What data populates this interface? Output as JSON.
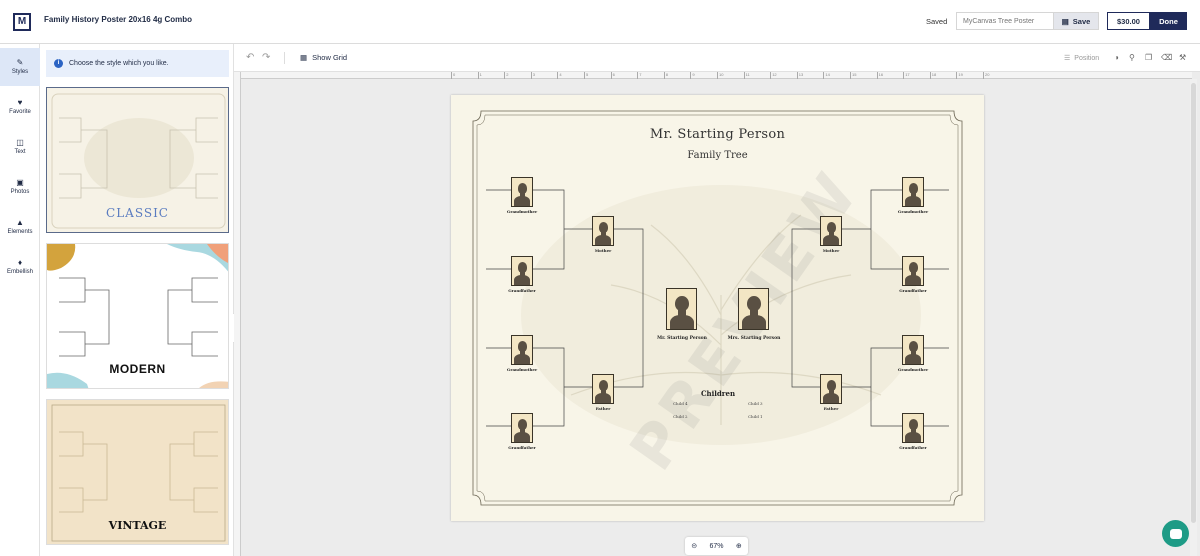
{
  "app": {
    "logo_letter": "M",
    "document_title": "Family History Poster 20x16 4g Combo",
    "save_status": "Saved",
    "name_placeholder": "MyCanvas Tree Poster",
    "save_label": "Save",
    "price": "$30.00",
    "done_label": "Done"
  },
  "leftnav": {
    "items": [
      {
        "label": "Styles",
        "icon": "styles-icon"
      },
      {
        "label": "Favorite",
        "icon": "heart-icon"
      },
      {
        "label": "Text",
        "icon": "text-icon"
      },
      {
        "label": "Photos",
        "icon": "photo-icon"
      },
      {
        "label": "Elements",
        "icon": "elements-icon"
      },
      {
        "label": "Embellish",
        "icon": "embellish-icon"
      }
    ]
  },
  "stylepanel": {
    "info": "Choose the style which you like.",
    "styles": [
      {
        "label": "CLASSIC"
      },
      {
        "label": "MODERN"
      },
      {
        "label": "VINTAGE"
      }
    ]
  },
  "toolbar": {
    "show_grid": "Show Grid",
    "position": "Position"
  },
  "ruler": {
    "ticks": [
      "0",
      "1",
      "2",
      "3",
      "4",
      "5",
      "6",
      "7",
      "8",
      "9",
      "10",
      "11",
      "12",
      "13",
      "14",
      "15",
      "16",
      "17",
      "18",
      "19",
      "20"
    ]
  },
  "poster": {
    "title": "Mr. Starting Person",
    "subtitle": "Family Tree",
    "watermark": "PREVIEW",
    "grand_left": [
      "Grandmother",
      "Grandfather",
      "Grandmother",
      "Grandfather"
    ],
    "grand_right": [
      "Grandmother",
      "Grandfather",
      "Grandmother",
      "Grandfather"
    ],
    "parent_left": [
      "Mother",
      "Father"
    ],
    "parent_right": [
      "Mother",
      "Father"
    ],
    "center_left": "Mr. Starting Person",
    "center_right": "Mrs. Starting Person",
    "children_title": "Children",
    "children": [
      "Child 4",
      "Child 3",
      "Child 2",
      "Child 1"
    ]
  },
  "zoom": {
    "level": "67%"
  },
  "colors": {
    "brand": "#1f2a5a",
    "accent": "#2c64c4",
    "poster_bg": "#f8f5e8",
    "chat": "#1e9b86"
  }
}
